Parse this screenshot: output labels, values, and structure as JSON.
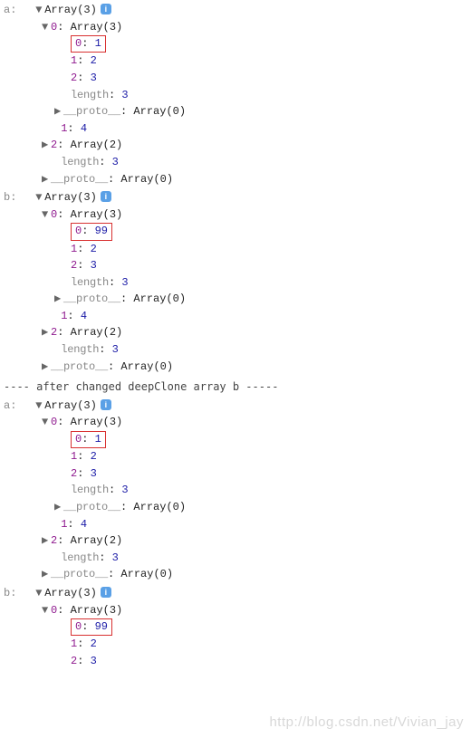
{
  "arrayLabel": "Array",
  "info": "i",
  "sections": {
    "a1": {
      "label": "a:",
      "size": 3,
      "child0": {
        "size": 3,
        "hlKey": "0",
        "hlVal": "1",
        "e1k": "1",
        "e1v": "2",
        "e2k": "2",
        "e2v": "3",
        "len": "3",
        "protoSize": 0
      },
      "e1k": "1",
      "e1v": "4",
      "e2size": 2,
      "len": "3",
      "protoSize": 0
    },
    "b1": {
      "label": "b:",
      "size": 3,
      "child0": {
        "size": 3,
        "hlKey": "0",
        "hlVal": "99",
        "e1k": "1",
        "e1v": "2",
        "e2k": "2",
        "e2v": "3",
        "len": "3",
        "protoSize": 0
      },
      "e1k": "1",
      "e1v": "4",
      "e2size": 2,
      "len": "3",
      "protoSize": 0
    },
    "a2": {
      "label": "a:",
      "size": 3,
      "child0": {
        "size": 3,
        "hlKey": "0",
        "hlVal": "1",
        "e1k": "1",
        "e1v": "2",
        "e2k": "2",
        "e2v": "3",
        "len": "3",
        "protoSize": 0
      },
      "e1k": "1",
      "e1v": "4",
      "e2size": 2,
      "len": "3",
      "protoSize": 0
    },
    "b2": {
      "label": "b:",
      "size": 3,
      "child0": {
        "size": 3,
        "hlKey": "0",
        "hlVal": "99",
        "e1k": "1",
        "e1v": "2",
        "e2k": "2",
        "e2v": "3"
      }
    }
  },
  "labels": {
    "length": "length",
    "proto": "__proto__",
    "colon": ": ",
    "openParen": "(",
    "closeParen": ")"
  },
  "divider": "---- after changed deepClone array b -----",
  "watermark": "http://blog.csdn.net/Vivian_jay",
  "arrows": {
    "down": "▼",
    "right": "▶"
  }
}
